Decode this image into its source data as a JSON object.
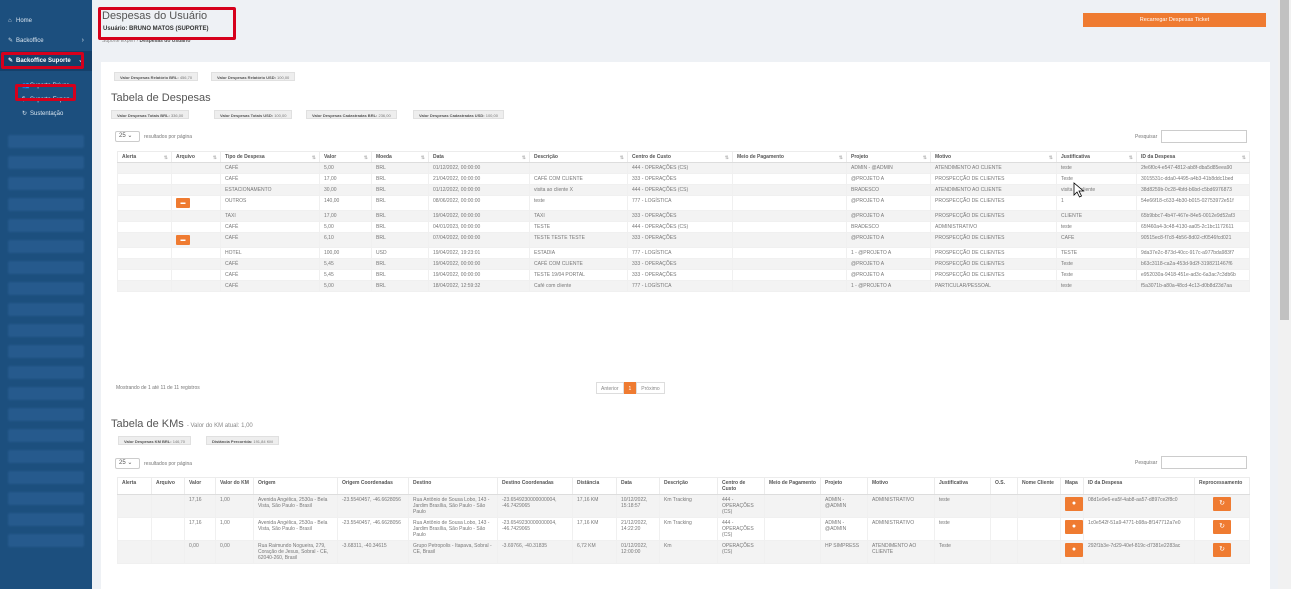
{
  "sidebar": {
    "items": [
      {
        "label": "Home",
        "icon": "home-icon"
      },
      {
        "label": "Backoffice",
        "icon": "edit-icon"
      },
      {
        "label": "Backoffice Suporte",
        "icon": "edit-icon"
      }
    ],
    "subitems": [
      {
        "label": "Suporte Driver",
        "icon": "users-icon"
      },
      {
        "label": "Suporte Expen",
        "icon": "dollar-icon"
      },
      {
        "label": "Sustentação",
        "icon": "refresh-icon"
      }
    ]
  },
  "header": {
    "title": "Despesas do Usuário",
    "user_line": "Usuário: BRUNO MATOS (SUPORTE)",
    "breadcrumb_parent": "Suporte Expen",
    "breadcrumb_sep": "›",
    "breadcrumb_current": "Despesas do Usuário",
    "reload_button": "Recarregar Despesas Ticket"
  },
  "summary": {
    "brl_label": "Valor Despesas Relatório BRL",
    "brl_value": "456,70",
    "usd_label": "Valor Despesas Relatório USD",
    "usd_value": "100,00"
  },
  "despesas": {
    "title": "Tabela de Despesas",
    "badges": [
      {
        "label": "Valor Despesas Totais BRL",
        "value": "336,00"
      },
      {
        "label": "Valor Despesas Totais USD",
        "value": "100,00"
      },
      {
        "label": "Valor Despesas Cadastradas BRL",
        "value": "236,00"
      },
      {
        "label": "Valor Despesas Cadastradas USD",
        "value": "100,00"
      }
    ],
    "length_value": "25",
    "length_label": "resultados por página",
    "search_label": "Pesquisar",
    "columns": [
      "Alerta",
      "Arquivo",
      "Tipo de Despesa",
      "Valor",
      "Moeda",
      "Data",
      "Descrição",
      "Centro de Custo",
      "Meio de Pagamento",
      "Projeto",
      "Motivo",
      "Justificativa",
      "ID da Despesa"
    ],
    "rows": [
      [
        "",
        "",
        "CAFÉ",
        "5,00",
        "BRL",
        "01/12/2022, 00:00:00",
        "",
        "444 - OPERAÇÕES (CS)",
        "",
        "ADMIN - @ADMIN",
        "ATENDIMENTO AO CLIENTE",
        "teste",
        "2fe6f0c4-e547-4812-ab8f-dba5d85eea90"
      ],
      [
        "",
        "",
        "CAFÉ",
        "17,00",
        "BRL",
        "21/04/2022, 00:00:00",
        "CAFÉ COM CLIENTE",
        "333 - OPERAÇÕES",
        "",
        "@PROJETO A",
        "PROSPECÇÃO DE CLIENTES",
        "Teste",
        "3015531c-dda0-4495-a4b3-41b8ddc1bed"
      ],
      [
        "",
        "",
        "ESTACIONAMENTO",
        "30,00",
        "BRL",
        "01/12/2022, 00:00:00",
        "visita ao cliente X",
        "444 - OPERAÇÕES (CS)",
        "",
        "BRADESCO",
        "ATENDIMENTO AO CLIENTE",
        "visita ao cliente",
        "38d8259b-0c28-4bfd-b6bd-c5bd6976873"
      ],
      [
        "",
        "file",
        "OUTROS",
        "140,00",
        "BRL",
        "08/06/2022, 00:00:00",
        "teste",
        "777 - LOGÍSTICA",
        "",
        "@PROJETO A",
        "PROSPECÇÃO DE CLIENTES",
        "1",
        "54e66f18-c633-4b30-b015-02753972e51f"
      ],
      [
        "",
        "",
        "TAXI",
        "17,00",
        "BRL",
        "19/04/2022, 00:00:00",
        "TAXI",
        "333 - OPERAÇÕES",
        "",
        "@PROJETO A",
        "PROSPECÇÃO DE CLIENTES",
        "CLIENTE",
        "65b9bbc7-4b47-467e-84e5-0012e9d52af3"
      ],
      [
        "",
        "",
        "CAFÉ",
        "5,00",
        "BRL",
        "04/01/2023, 00:00:00",
        "TESTE",
        "444 - OPERAÇÕES (CS)",
        "",
        "BRADESCO",
        "ADMINISTRATIVO",
        "teste",
        "65f460a4-3c48-4130-aa05-2c1bc1172611"
      ],
      [
        "",
        "file",
        "CAFÉ",
        "6,10",
        "BRL",
        "07/04/2022, 00:00:00",
        "TESTE TESTE TESTE",
        "333 - OPERAÇÕES",
        "",
        "@PROJETO A",
        "PROSPECÇÃO DE CLIENTES",
        "CAFE",
        "90515ec8-f7c8-4b56-8d02-cf0546fcd021"
      ],
      [
        "",
        "",
        "HOTEL",
        "100,00",
        "USD",
        "19/04/2022, 19:23:01",
        "ESTADIA",
        "777 - LOGÍSTICA",
        "",
        "1 - @PROJETO A",
        "PROSPECÇÃO DE CLIENTES",
        "TESTE",
        "9da37e2c-873d-40cc-917c-a977bda983f7"
      ],
      [
        "",
        "",
        "CAFÉ",
        "5,45",
        "BRL",
        "19/04/2022, 00:00:00",
        "CAFÉ COM CLIENTE",
        "333 - OPERAÇÕES",
        "",
        "@PROJETO A",
        "PROSPECÇÃO DE CLIENTES",
        "Teste",
        "b63c3118-ca2a-453d-9d2f-3198211467f6"
      ],
      [
        "",
        "",
        "CAFÉ",
        "5,45",
        "BRL",
        "19/04/2022, 00:00:00",
        "TESTE 19/04 PORTAL",
        "333 - OPERAÇÕES",
        "",
        "@PROJETO A",
        "PROSPECÇÃO DE CLIENTES",
        "Teste",
        "e952030a-9418-451e-ad3c-6a3ac7c3db6b"
      ],
      [
        "",
        "",
        "CAFÉ",
        "5,00",
        "BRL",
        "18/04/2022, 12:59:32",
        "Café com cliente",
        "777 - LOGÍSTICA",
        "",
        "1 - @PROJETO A",
        "PARTICULAR/PESSOAL",
        "teste",
        "f5a3071b-a80a-48cd-4c13-d0b8d23d7aa"
      ]
    ],
    "info": "Mostrando de 1 até 11 de 11 registros",
    "prev": "Anterior",
    "page": "1",
    "next": "Próximo"
  },
  "kms": {
    "title": "Tabela de KMs",
    "subtitle": "- Valor do KM atual: 1,00",
    "badges": [
      {
        "label": "Valor Despesas KM BRL",
        "value": "146,70"
      },
      {
        "label": "Distância Percorrida",
        "value": "191,84 KM"
      }
    ],
    "length_value": "25",
    "length_label": "resultados por página",
    "search_label": "Pesquisar",
    "columns": [
      "Alerta",
      "Arquivo",
      "Valor",
      "Valor do KM",
      "Origem",
      "Origem Coordenadas",
      "Destino",
      "Destino Coordenadas",
      "Distância",
      "Data",
      "Descrição",
      "Centro de Custo",
      "Meio de Pagamento",
      "Projeto",
      "Motivo",
      "Justificativa",
      "O.S.",
      "Nome Cliente",
      "Mapa",
      "ID da Despesa",
      "Reprocessamento"
    ],
    "rows": [
      [
        "",
        "",
        "17,16",
        "1,00",
        "Avenida Angélica, 2530a - Bela Vista, São Paulo - Brasil",
        "-23.5540457, -46.6628056",
        "Rua Antônio de Sousa Lobo, 143 - Jardim Brasília, São Paulo - São Paulo",
        "-23.6549230000000004, -46.7429065",
        "17,16 KM",
        "10/12/2022, 15:18:57",
        "Km Tracking",
        "444 - OPERAÇÕES (CS)",
        "",
        "ADMIN - @ADMIN",
        "ADMINISTRATIVO",
        "teste",
        "",
        "",
        "map",
        "08d1e9e6-ea5f-4ab8-aa57-d897ce2f8c0",
        "reprocess"
      ],
      [
        "",
        "",
        "17,16",
        "1,00",
        "Avenida Angélica, 2530a - Bela Vista, São Paulo - Brasil",
        "-23.5540457, -46.6628056",
        "Rua Antônio de Sousa Lobo, 143 - Jardim Brasília, São Paulo - São Paulo",
        "-23.6549230000000004, -46.7429065",
        "17,16 KM",
        "21/12/2022, 14:22:20",
        "Km Tracking",
        "444 - OPERAÇÕES (CS)",
        "",
        "ADMIN - @ADMIN",
        "ADMINISTRATIVO",
        "teste",
        "",
        "",
        "map",
        "1c0e542f-51a9-4771-b98a-8f147712a7e0",
        "reprocess"
      ],
      [
        "",
        "",
        "0,00",
        "0,00",
        "Rua Raimundo Nogueira, 279, Coração de Jesus, Sobral - CE, 62040-260, Brasil",
        "-3.68311, -40.34615",
        "Grupo Petropolis - Itapava, Sobral - CE, Brasil",
        "-3.69766, -40.31835",
        "6,72 KM",
        "01/12/2022, 12:00:00",
        "Km",
        "OPERAÇÕES (CS)",
        "",
        "HP SIMPRESS",
        "ATENDIMENTO AO CLIENTE",
        "Teste",
        "",
        "",
        "map",
        "292f1b3e-7d29-40ef-819c-d7381e2283ac",
        "reprocess"
      ]
    ]
  }
}
